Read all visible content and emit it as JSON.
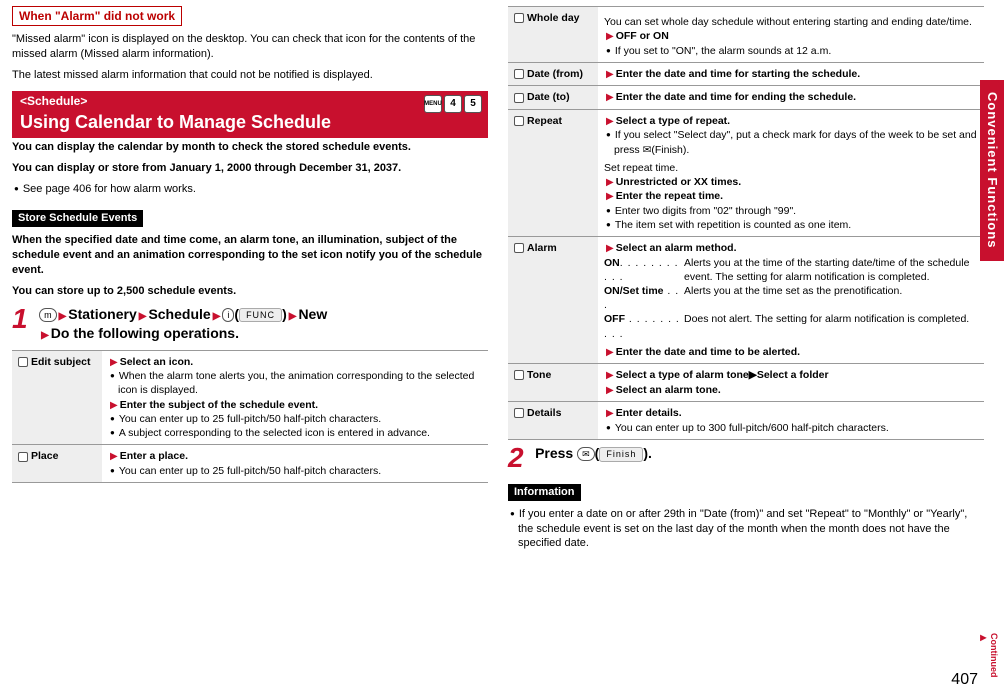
{
  "left": {
    "box1_title": "When \"Alarm\" did not work",
    "box1_p1": "\"Missed alarm\" icon is displayed on the desktop. You can check that icon for the contents of the missed alarm (Missed alarm information).",
    "box1_p2": "The latest missed alarm information that could not be notified is displayed.",
    "section_sub": "<Schedule>",
    "section_title": "Using Calendar to Manage Schedule",
    "section_icon_menu": "MENU",
    "section_icon_4": "4",
    "section_icon_5": "5",
    "intro_b1": "You can display the calendar by month to check the stored schedule events.",
    "intro_b2": "You can display or store from January 1, 2000 through December 31, 2037.",
    "intro_bullet": "See page 406 for how alarm works.",
    "store_title": "Store Schedule Events",
    "store_b1": "When the specified date and time come, an alarm tone, an illumination, subject of the schedule event and an animation corresponding to the set icon notify you of the schedule event.",
    "store_b2": "You can store up to 2,500 schedule events.",
    "step1_num": "1",
    "step1_menu_icon": "m",
    "step1_a": "Stationery",
    "step1_b": "Schedule",
    "step1_key1": "i",
    "step1_func": "FUNC",
    "step1_c": "New",
    "step1_d": "Do the following operations.",
    "table": [
      {
        "label": "Edit subject",
        "lines": [
          {
            "tri": true,
            "b": true,
            "t": "Select an icon."
          },
          {
            "bul": true,
            "t": "When the alarm tone alerts you, the animation corresponding to the selected icon is displayed."
          },
          {
            "tri": true,
            "b": true,
            "t": "Enter the subject of the schedule event."
          },
          {
            "bul": true,
            "t": "You can enter up to 25 full-pitch/50 half-pitch characters."
          },
          {
            "bul": true,
            "t": "A subject corresponding to the selected icon is entered in advance."
          }
        ]
      },
      {
        "label": "Place",
        "lines": [
          {
            "tri": true,
            "b": true,
            "t": "Enter a place."
          },
          {
            "bul": true,
            "t": "You can enter up to 25 full-pitch/50 half-pitch characters."
          }
        ]
      }
    ]
  },
  "right": {
    "table": [
      {
        "label": "Whole day",
        "lines": [
          {
            "t": "You can set whole day schedule without entering starting and ending date/time."
          },
          {
            "tri": true,
            "b": true,
            "t": "OFF or ON"
          },
          {
            "bul": true,
            "t": "If you set to \"ON\", the alarm sounds at 12 a.m."
          }
        ]
      },
      {
        "label": "Date (from)",
        "lines": [
          {
            "tri": true,
            "b": true,
            "t": "Enter the date and time for starting the schedule."
          }
        ]
      },
      {
        "label": "Date (to)",
        "lines": [
          {
            "tri": true,
            "b": true,
            "t": "Enter the date and time for ending the schedule."
          }
        ]
      },
      {
        "label": "Repeat",
        "lines": [
          {
            "tri": true,
            "b": true,
            "t": "Select a type of repeat."
          },
          {
            "bul": true,
            "t": "If you select \"Select day\", put a check mark for days of the week to be set and press ✉(Finish)."
          },
          {
            "t": "Set repeat time."
          },
          {
            "tri": true,
            "b": true,
            "t": "Unrestricted or XX times."
          },
          {
            "tri": true,
            "b": true,
            "t": "Enter the repeat time."
          },
          {
            "bul": true,
            "t": "Enter two digits from \"02\" through \"99\"."
          },
          {
            "bul": true,
            "t": "The item set with repetition is counted as one item."
          }
        ]
      },
      {
        "label": "Alarm",
        "alarm": true,
        "head": "Select an alarm method.",
        "rows": [
          {
            "k": "ON",
            "d": ". . . . . . . . . . .",
            "v": "Alerts you at the time of the starting date/time of the schedule event. The setting for alarm notification is completed."
          },
          {
            "k": "ON/Set time",
            "d": " . . .",
            "v": "Alerts you at the time set as the prenotification."
          },
          {
            "k": "OFF",
            "d": " . . . . . . . . . .",
            "v": "Does not alert. The setting for alarm notification is completed."
          }
        ],
        "tail": "Enter the date and time to be alerted."
      },
      {
        "label": "Tone",
        "lines": [
          {
            "tri": true,
            "b": true,
            "t": "Select a type of alarm tone▶Select a folder"
          },
          {
            "tri": true,
            "b": true,
            "t": "Select an alarm tone."
          }
        ]
      },
      {
        "label": "Details",
        "lines": [
          {
            "tri": true,
            "b": true,
            "t": "Enter details."
          },
          {
            "bul": true,
            "t": "You can enter up to 300 full-pitch/600 half-pitch characters."
          }
        ]
      }
    ],
    "step2_num": "2",
    "step2_a": "Press",
    "step2_key": "✉",
    "step2_badge": "Finish",
    "step2_end": ".",
    "info_title": "Information",
    "info_bullet": "If you enter a date on or after 29th in \"Date (from)\" and set \"Repeat\" to \"Monthly\" or \"Yearly\", the schedule event is set on the last day of the month when the month does not have the specified date."
  },
  "side_tab": "Convenient Functions",
  "page_num": "407",
  "continued": "Continued"
}
